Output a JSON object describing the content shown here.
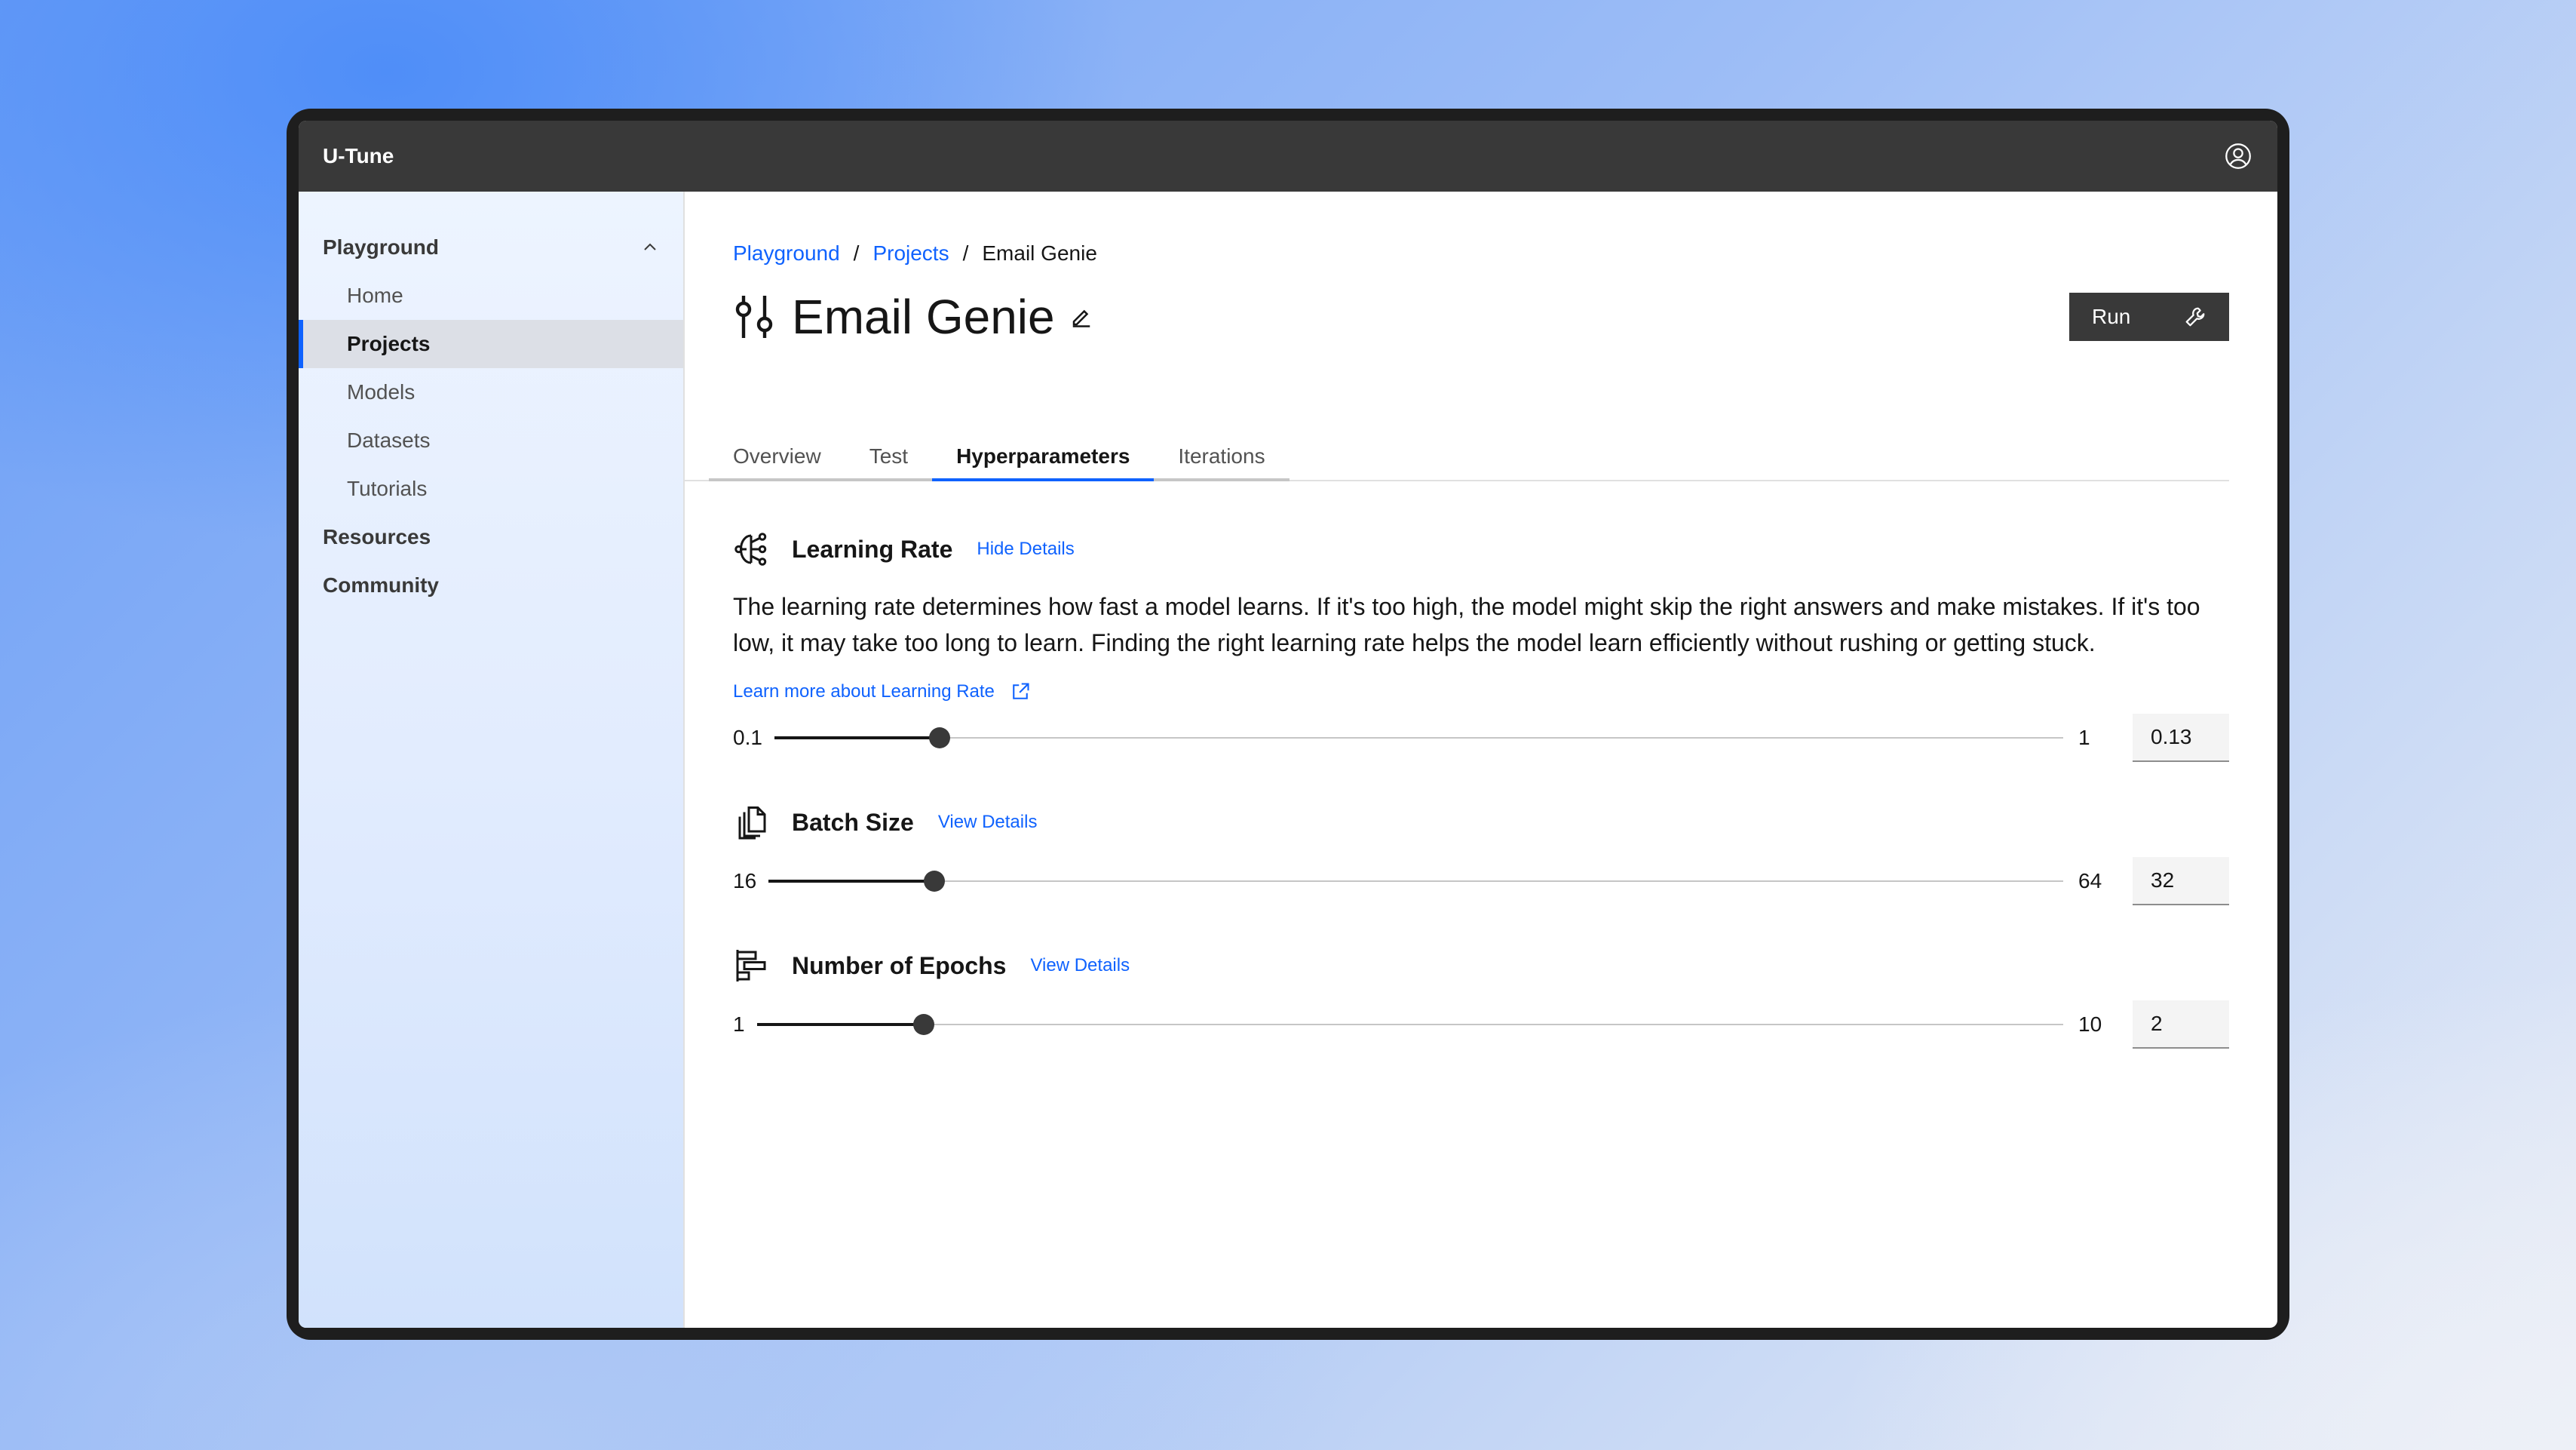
{
  "app": {
    "title": "U-Tune"
  },
  "sidebar": {
    "group": {
      "label": "Playground"
    },
    "items": [
      {
        "label": "Home",
        "active": false
      },
      {
        "label": "Projects",
        "active": true
      },
      {
        "label": "Models",
        "active": false
      },
      {
        "label": "Datasets",
        "active": false
      },
      {
        "label": "Tutorials",
        "active": false
      }
    ],
    "top_items": [
      {
        "label": "Resources"
      },
      {
        "label": "Community"
      }
    ]
  },
  "breadcrumb": {
    "items": [
      "Playground",
      "Projects"
    ],
    "separator": "/",
    "current": "Email Genie"
  },
  "page": {
    "title": "Email Genie"
  },
  "run_button": {
    "label": "Run"
  },
  "tabs": [
    {
      "label": "Overview",
      "active": false
    },
    {
      "label": "Test",
      "active": false
    },
    {
      "label": "Hyperparameters",
      "active": true
    },
    {
      "label": "Iterations",
      "active": false
    }
  ],
  "hyperparameters": {
    "learning_rate": {
      "title": "Learning Rate",
      "details_link": "Hide Details",
      "description": "The learning rate determines how fast a model learns. If it's too high, the model might skip the right answers and make mistakes. If it's too low, it may take too long to learn. Finding the right learning rate helps the model learn efficiently without rushing or getting stuck.",
      "learn_more": "Learn more about Learning Rate",
      "min_label": "0.1",
      "max_label": "1",
      "value": "0.13",
      "fill_fraction": 0.128
    },
    "batch_size": {
      "title": "Batch Size",
      "details_link": "View Details",
      "min_label": "16",
      "max_label": "64",
      "value": "32",
      "fill_fraction": 0.128
    },
    "epochs": {
      "title": "Number of Epochs",
      "details_link": "View Details",
      "min_label": "1",
      "max_label": "10",
      "value": "2",
      "fill_fraction": 0.128
    }
  },
  "colors": {
    "accent": "#0f62fe",
    "header_bg": "#393939",
    "text": "#161616"
  }
}
